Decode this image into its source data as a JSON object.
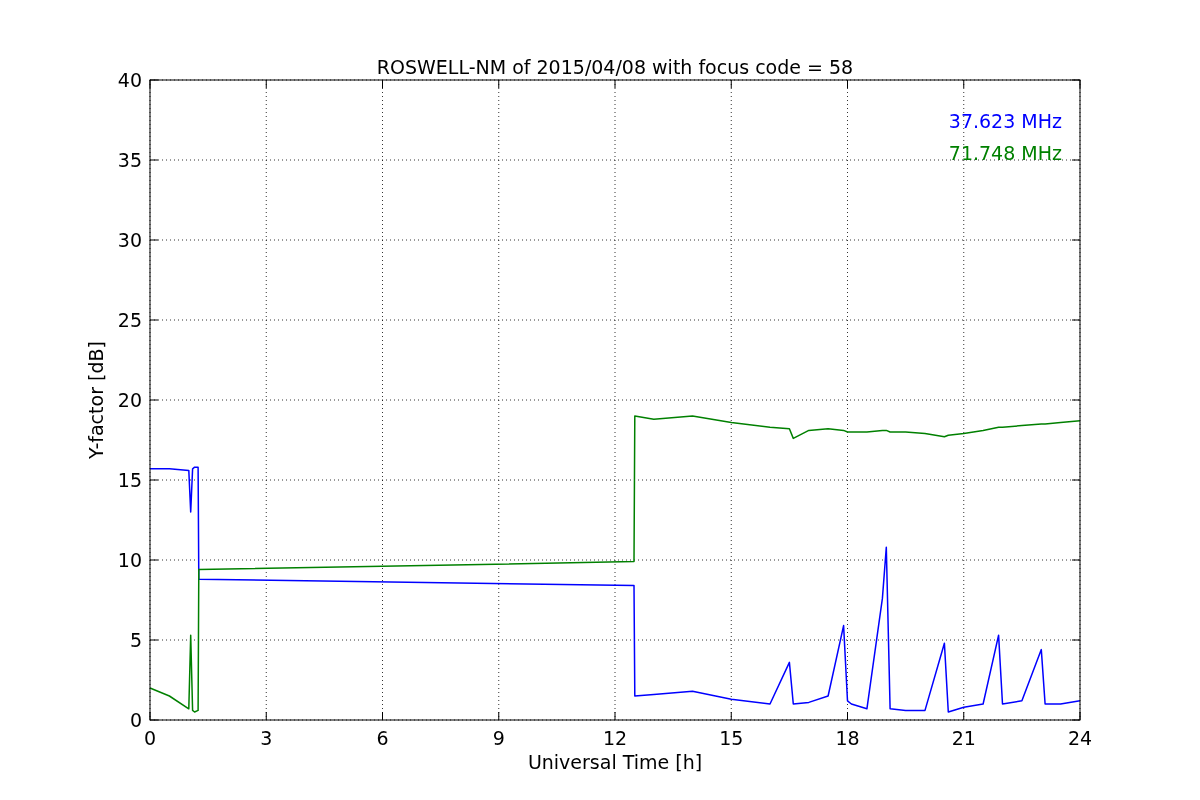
{
  "chart_data": {
    "type": "line",
    "title": "ROSWELL-NM of 2015/04/08 with focus code = 58",
    "xlabel": "Universal Time [h]",
    "ylabel": "Y-factor [dB]",
    "x": [
      0,
      0.5,
      1,
      1.05,
      1.1,
      1.15,
      1.24,
      1.26,
      12.49,
      12.51,
      13,
      14,
      15,
      16,
      16.5,
      16.6,
      17,
      17.5,
      17.9,
      18,
      18.1,
      18.5,
      18.9,
      19,
      19.1,
      19.5,
      20,
      20.5,
      20.6,
      21,
      21.5,
      21.9,
      22,
      22.5,
      23,
      23.1,
      23.5,
      24
    ],
    "series": [
      {
        "name": "37.623 MHz",
        "color": "#0000ff",
        "values": [
          15.7,
          15.7,
          15.6,
          13,
          15.7,
          15.8,
          15.8,
          8.8,
          8.4,
          1.5,
          1.6,
          1.8,
          1.3,
          1.0,
          3.6,
          1.0,
          1.1,
          1.5,
          5.9,
          1.2,
          1.0,
          0.7,
          7.6,
          10.8,
          0.7,
          0.6,
          0.6,
          4.8,
          0.5,
          0.8,
          1.0,
          5.3,
          1.0,
          1.2,
          4.4,
          1.0,
          1.0,
          1.2
        ]
      },
      {
        "name": "71.748 MHz",
        "color": "#008000",
        "values": [
          2.0,
          1.5,
          0.7,
          5.3,
          0.6,
          0.5,
          0.6,
          9.4,
          9.9,
          19,
          18.8,
          19.0,
          18.6,
          18.3,
          18.2,
          17.6,
          18.1,
          18.2,
          18.1,
          18.0,
          18.0,
          18.0,
          18.1,
          18.1,
          18.0,
          18.0,
          17.9,
          17.7,
          17.8,
          17.9,
          18.1,
          18.3,
          18.3,
          18.4,
          18.5,
          18.5,
          18.6,
          18.7
        ]
      }
    ],
    "xlim": [
      0,
      24
    ],
    "ylim": [
      0,
      40
    ],
    "xticks": [
      0,
      3,
      6,
      9,
      12,
      15,
      18,
      21,
      24
    ],
    "yticks": [
      0,
      5,
      10,
      15,
      20,
      25,
      30,
      35,
      40
    ],
    "grid": true
  }
}
